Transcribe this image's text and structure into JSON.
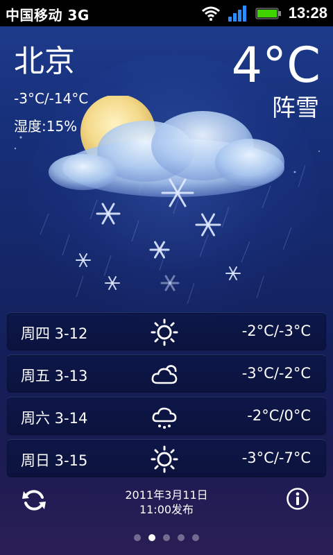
{
  "status_bar": {
    "carrier": "中国移动 3G",
    "time": "13:28",
    "icons": [
      "wifi-icon",
      "signal-icon",
      "battery-icon"
    ],
    "battery_color": "#3fd400"
  },
  "current": {
    "city": "北京",
    "temperature": "4°C",
    "condition": "阵雪",
    "temp_range": "-3°C/-14°C",
    "humidity": "湿度:15%",
    "illustration": [
      "moon",
      "cloud",
      "snowflakes",
      "snow-streaks"
    ]
  },
  "forecast": [
    {
      "day": "周四 3-12",
      "icon": "sunny-icon",
      "temp": "-2°C/-3°C"
    },
    {
      "day": "周五 3-13",
      "icon": "cloudy-icon",
      "temp": "-3°C/-2°C"
    },
    {
      "day": "周六 3-14",
      "icon": "snow-cloud-icon",
      "temp": "-2°C/0°C"
    },
    {
      "day": "周日 3-15",
      "icon": "sunny-icon",
      "temp": "-3°C/-7°C"
    }
  ],
  "footer": {
    "publish_date": "2011年3月11日",
    "publish_time": "11:00发布",
    "refresh_icon": "refresh-icon",
    "info_icon": "info-icon"
  },
  "pager": {
    "count": 5,
    "active": 1
  },
  "colors": {
    "background_top": "#1d3a8a",
    "background_bottom": "#2a1f55",
    "text": "#ffffff"
  }
}
